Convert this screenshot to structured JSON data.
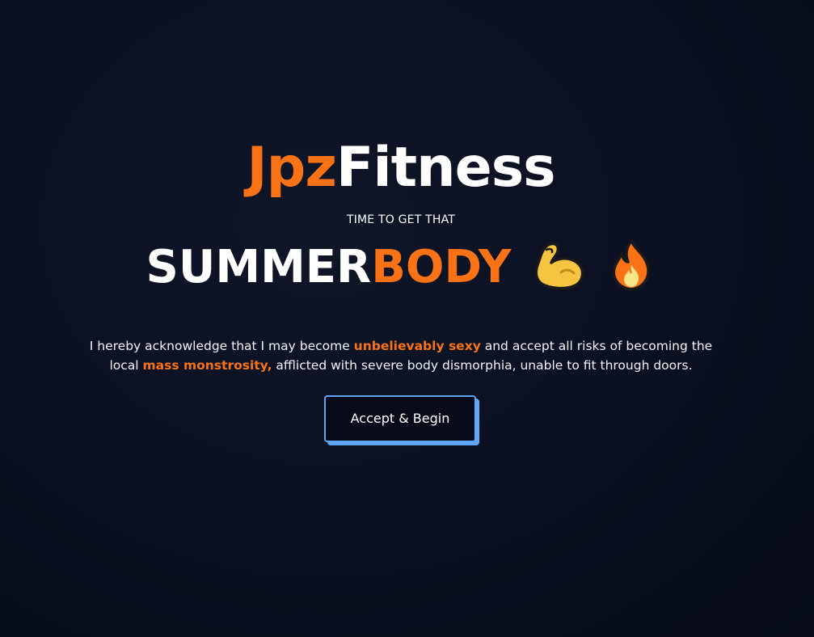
{
  "brand": {
    "part1": "Jpz",
    "part2": "Fitness"
  },
  "tagline": "TIME TO GET THAT",
  "hero": {
    "part1": "SUMMER",
    "part2": "BODY",
    "icons": [
      "flexed-biceps-icon",
      "fire-icon"
    ]
  },
  "disclaimer": {
    "t1": "I hereby acknowledge that I may become ",
    "h1": "unbelievably sexy",
    "t2": " and accept all risks of becoming the local ",
    "h2": "mass monstrosity,",
    "t3": " afflicted with severe body dismorphia, unable to fit through doors."
  },
  "cta": {
    "label": "Accept & Begin"
  },
  "colors": {
    "accent": "#f97316",
    "button_border": "#60a5fa",
    "background": "#0b1122"
  }
}
